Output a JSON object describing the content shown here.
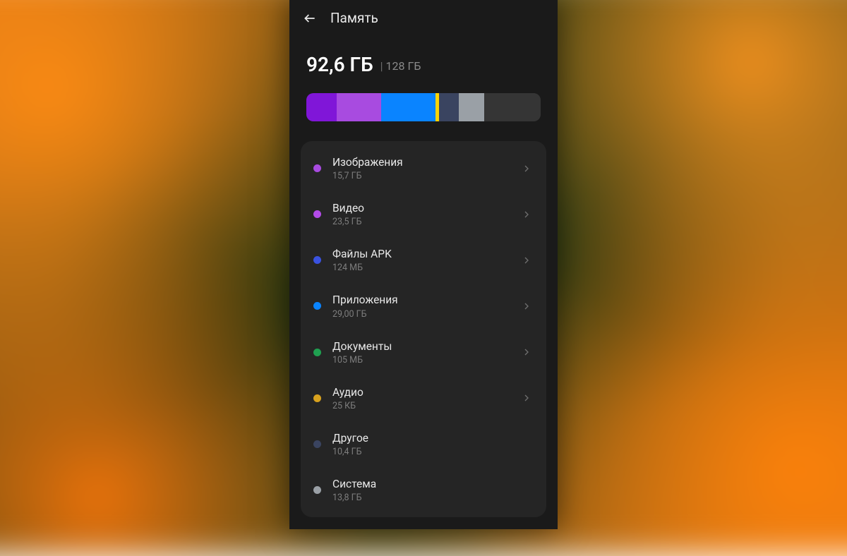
{
  "header": {
    "title": "Память"
  },
  "summary": {
    "used": "92,6 ГБ",
    "total": "128 ГБ"
  },
  "bar_segments": [
    {
      "color": "#8016d8",
      "pct": 13
    },
    {
      "color": "#a84be0",
      "pct": 19
    },
    {
      "color": "#0a84ff",
      "pct": 23
    },
    {
      "color": "#ffd400",
      "pct": 1.5
    },
    {
      "color": "#3a4460",
      "pct": 8.5
    },
    {
      "color": "#9aa0a6",
      "pct": 11
    },
    {
      "color": "#353535",
      "pct": 24
    }
  ],
  "categories": [
    {
      "label": "Изображения",
      "size": "15,7 ГБ",
      "color": "#a84be0",
      "nav": true
    },
    {
      "label": "Видео",
      "size": "23,5 ГБ",
      "color": "#b34be8",
      "nav": true
    },
    {
      "label": "Файлы APK",
      "size": "124 МБ",
      "color": "#3a52e0",
      "nav": true
    },
    {
      "label": "Приложения",
      "size": "29,00  ГБ",
      "color": "#0a84ff",
      "nav": true
    },
    {
      "label": "Документы",
      "size": "105 МБ",
      "color": "#1fa050",
      "nav": true
    },
    {
      "label": "Аудио",
      "size": "25 КБ",
      "color": "#d8a21e",
      "nav": true
    },
    {
      "label": "Другое",
      "size": "10,4 ГБ",
      "color": "#3a4460",
      "nav": false
    },
    {
      "label": "Система",
      "size": "13,8 ГБ",
      "color": "#9aa0a6",
      "nav": false
    }
  ]
}
